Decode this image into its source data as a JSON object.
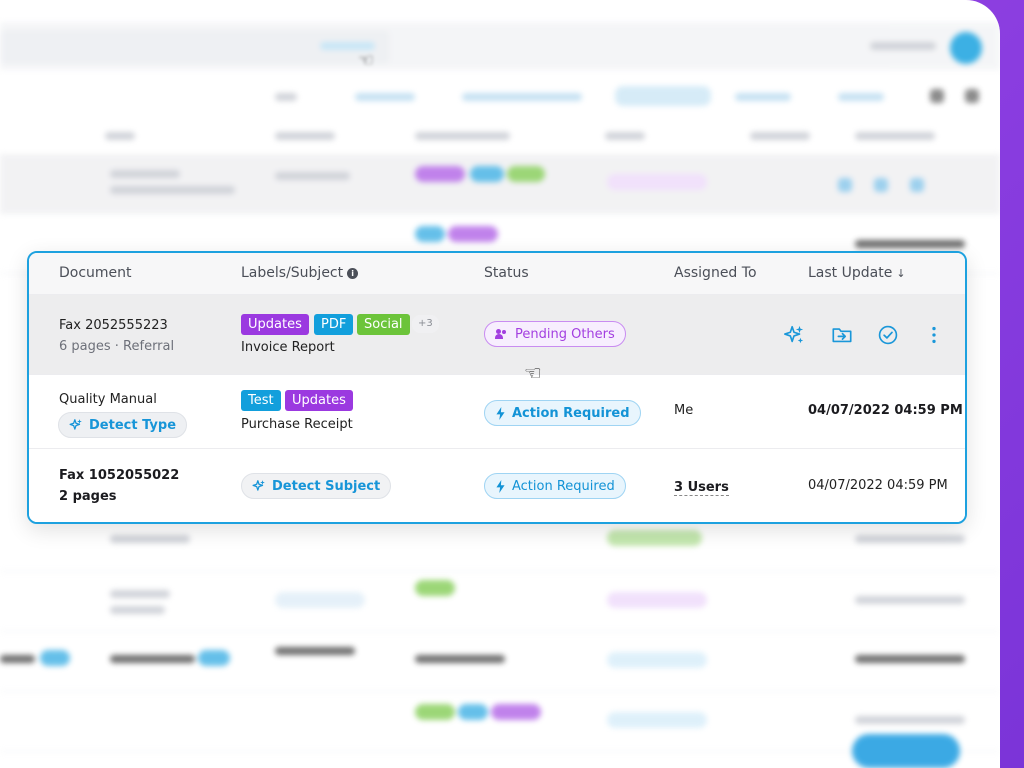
{
  "table": {
    "headers": {
      "document": "Document",
      "labels_subject": "Labels/Subject",
      "status": "Status",
      "assigned_to": "Assigned To",
      "last_update": "Last Update"
    },
    "rows": [
      {
        "doc_title": "Fax 2052555223",
        "doc_sub": "6 pages · Referral",
        "tags": [
          {
            "label": "Updates",
            "color": "#9b39e0"
          },
          {
            "label": "PDF",
            "color": "#129fdc"
          },
          {
            "label": "Social",
            "color": "#6cc43a"
          }
        ],
        "more_tags": "+3",
        "subject": "Invoice Report",
        "status": "Pending Others",
        "assigned_to": "",
        "last_update": ""
      },
      {
        "doc_title": "Quality Manual",
        "detect_type_label": "Detect Type",
        "tags": [
          {
            "label": "Test",
            "color": "#129fdc"
          },
          {
            "label": "Updates",
            "color": "#9b39e0"
          }
        ],
        "subject": "Purchase Receipt",
        "status": "Action Required",
        "assigned_to": "Me",
        "last_update": "04/07/2022 04:59 PM"
      },
      {
        "doc_title": "Fax 1052055022",
        "doc_sub": "2 pages",
        "detect_subject_label": "Detect Subject",
        "status": "Action Required",
        "assigned_to": "3 Users",
        "last_update": "04/07/2022 04:59 PM"
      }
    ]
  },
  "colors": {
    "accent_blue": "#1da1df",
    "purple": "#9b39e0",
    "green": "#6cc43a",
    "frame": "#8a3de0"
  },
  "icons": {
    "sparkle": "sparkle-icon",
    "move_folder": "folder-move-icon",
    "approve": "check-circle-icon",
    "more": "more-vertical-icon",
    "bolt": "bolt-icon",
    "users": "users-icon",
    "info": "info-icon",
    "sort": "sort-down-icon"
  }
}
